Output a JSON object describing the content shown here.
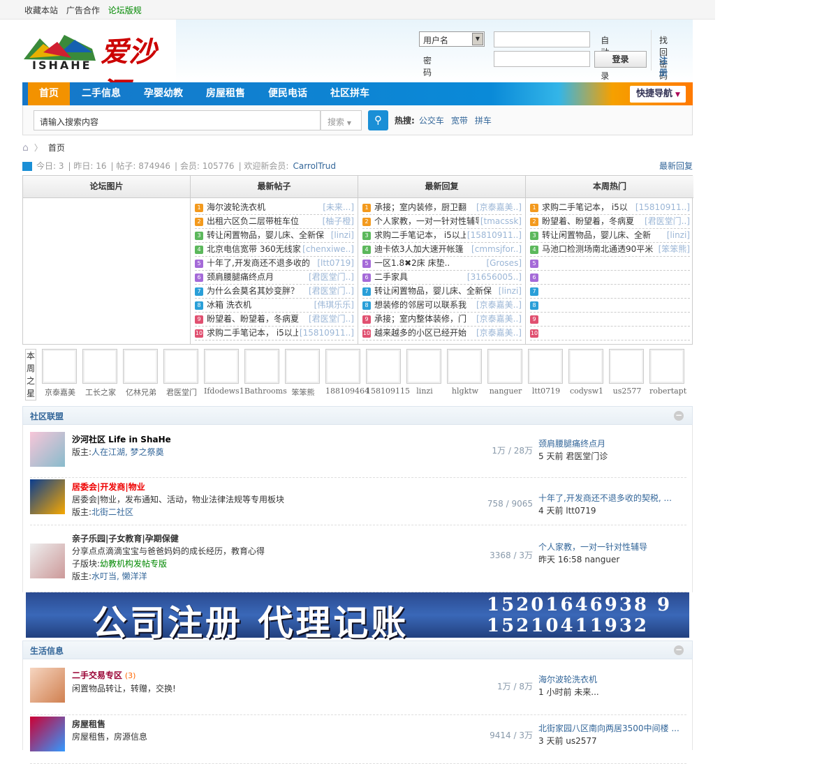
{
  "topbar": {
    "links": [
      "收藏本站",
      "广告合作",
      "论坛版规"
    ]
  },
  "logo": {
    "en": "ISHAHE",
    "cn": "爱沙河"
  },
  "login": {
    "user_select": "用户名",
    "password_label": "密码",
    "auto_login": "自动登录",
    "login_button": "登录",
    "find_password": "找回密码",
    "register": "注册"
  },
  "nav": {
    "items": [
      "首页",
      "二手信息",
      "孕婴幼教",
      "房屋租售",
      "便民电话",
      "社区拼车"
    ],
    "quick": "快捷导航"
  },
  "search": {
    "placeholder": "请输入搜索内容",
    "type": "搜索",
    "hot_label": "热搜:",
    "hot": [
      "公交车",
      "宽带",
      "拼车"
    ]
  },
  "breadcrumb": {
    "home": "首页"
  },
  "stats": {
    "today": "今日: 3",
    "yesterday": "昨日: 16",
    "posts": "帖子: 874946",
    "members": "会员: 105776",
    "welcome": "欢迎新会员:",
    "new_member": "CarrolTrud",
    "latest": "最新回复"
  },
  "grid": {
    "headers": [
      "论坛图片",
      "最新帖子",
      "最新回复",
      "本周热门"
    ],
    "num_colors": [
      "#f39a1e",
      "#f39a1e",
      "#5cb85c",
      "#5cb85c",
      "#a56ad8",
      "#a56ad8",
      "#2a9fd8",
      "#2a9fd8",
      "#e05070",
      "#e05070"
    ],
    "new_posts": [
      [
        "海尔波轮洗衣机",
        "[未来...]"
      ],
      [
        "出租六区负二层带桩车位",
        "[柚子橙]"
      ],
      [
        "转让闲置物品，婴儿床、全新保",
        "[linzi]"
      ],
      [
        "北京电信宽带 360无线家",
        "[chenxiwe..]"
      ],
      [
        "十年了,开发商还不退多收的",
        "[ltt0719]"
      ],
      [
        "颈肩腰腿痛终点月",
        "[君医堂门..]"
      ],
      [
        "为什么会莫名其妙变胖？",
        "[君医堂门..]"
      ],
      [
        "冰箱 洗衣机",
        "[伟琪乐乐]"
      ],
      [
        "盼望着、盼望着，冬病夏",
        "[君医堂门..]"
      ],
      [
        "求购二手笔记本， i5以上",
        "[15810911..]"
      ]
    ],
    "new_replies": [
      [
        "承接；室内装修，厨卫翻",
        "[京泰嘉美..]"
      ],
      [
        "个人家教，一对一针对性辅导",
        "[tmacssk]"
      ],
      [
        "求购二手笔记本， i5以上",
        "[15810911..]"
      ],
      [
        "迪卡侬3人加大速开帐篷",
        "[cmmsjfor..]"
      ],
      [
        "一区1.8✖2床  床垫..",
        "[Groses]"
      ],
      [
        "二手家具",
        "[31656005..]"
      ],
      [
        "转让闲置物品，婴儿床、全新保",
        "[linzi]"
      ],
      [
        "想装修的邻居可以联系我",
        "[京泰嘉美..]"
      ],
      [
        "承接；室内整体装修，门",
        "[京泰嘉美..]"
      ],
      [
        "越来越多的小区已经开始",
        "[京泰嘉美..]"
      ]
    ],
    "hot_week": [
      [
        "求购二手笔记本， i5以",
        "[15810911..]"
      ],
      [
        "盼望着、盼望着，冬病夏",
        "[君医堂门..]"
      ],
      [
        "转让闲置物品，婴儿床、全新",
        "[linzi]"
      ],
      [
        "马池口检测场南北通透90平米",
        "[笨笨熊]"
      ],
      [
        "",
        ""
      ],
      [
        "",
        ""
      ],
      [
        "",
        ""
      ],
      [
        "",
        ""
      ],
      [
        "",
        ""
      ],
      [
        "",
        ""
      ]
    ]
  },
  "stars": {
    "label": "本周之星",
    "names": [
      "京泰嘉美",
      "工长之家",
      "亿林兄弟",
      "君医堂门",
      "Ifdodews1",
      "Bathrooms",
      "笨笨熊",
      "188109464",
      "158109115",
      "linzi",
      "hlgktw",
      "nanguer",
      "ltt0719",
      "codysw1",
      "us2577",
      "robertapt"
    ]
  },
  "sections": [
    {
      "title": "社区联盟",
      "forums": [
        {
          "name": "沙河社区 Life in ShaHe",
          "desc": "",
          "sub_label": "",
          "sub": "",
          "mod_label": "版主:",
          "mods": "人在江湖, 梦之祭奠",
          "counts": "1万 / 28万",
          "last_title": "颈肩腰腿痛终点月",
          "last_meta": "5 天前 君医堂门诊"
        },
        {
          "name": "居委会|开发商|物业",
          "desc": "居委会|物业，发布通知、活动，物业法律法规等专用板块",
          "sub_label": "",
          "sub": "",
          "mod_label": "版主:",
          "mods": "北街二社区",
          "counts": "758 / 9065",
          "last_title": "十年了,开发商还不退多收的契税, ...",
          "last_meta": "4 天前 ltt0719"
        },
        {
          "name": "亲子乐园|子女教育|孕期保健",
          "desc": "分享点点滴滴宝宝与爸爸妈妈的成长经历，教育心得",
          "sub_label": "子版块:",
          "sub": "幼教机构发帖专版",
          "mod_label": "版主:",
          "mods": "水叮当, 懒洋洋",
          "counts": "3368 / 3万",
          "last_title": "个人家教，一对一针对性辅导",
          "last_meta": "昨天 16:58 nanguer"
        }
      ]
    },
    {
      "title": "生活信息",
      "forums": [
        {
          "name": "二手交易专区",
          "badge": "(3)",
          "desc": "闲置物品转让，转赠，交换!",
          "counts": "1万 / 8万",
          "last_title": "海尔波轮洗衣机",
          "last_meta": "1 小时前 未来..."
        },
        {
          "name": "房屋租售",
          "desc": "房屋租售，房源信息",
          "counts": "9414 / 3万",
          "last_title": "北街家园八区南向两居3500中间楼 ...",
          "last_meta": "3 天前 us2577"
        }
      ]
    }
  ],
  "banner": {
    "main": "公司注册 代理记账",
    "phone1": "15201646938 9",
    "phone2": "15210411932"
  }
}
